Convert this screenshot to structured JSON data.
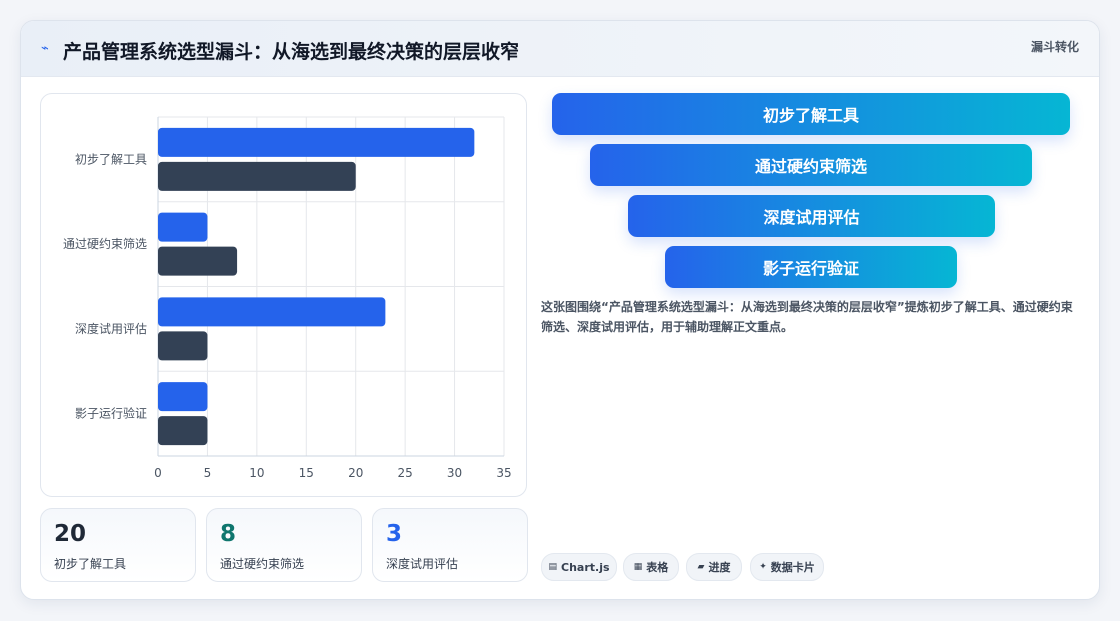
{
  "header": {
    "title": "产品管理系统选型漏斗：从海选到最终决策的层层收窄",
    "tag": "漏斗转化"
  },
  "chart_data": {
    "type": "bar",
    "orientation": "horizontal",
    "categories": [
      "初步了解工具",
      "通过硬约束筛选",
      "深度试用评估",
      "影子运行验证"
    ],
    "series": [
      {
        "values": [
          32,
          5,
          23,
          5
        ],
        "color": "#2563eb"
      },
      {
        "values": [
          20,
          8,
          5,
          5
        ],
        "color": "#334155"
      }
    ],
    "xlim": [
      0,
      35
    ],
    "xticks": [
      0,
      5,
      10,
      15,
      20,
      25,
      30,
      35
    ],
    "grid": true
  },
  "funnel": {
    "stages": [
      "初步了解工具",
      "通过硬约束筛选",
      "深度试用评估",
      "影子运行验证"
    ]
  },
  "description": "这张图围绕“产品管理系统选型漏斗：从海选到最终决策的层层收窄”提炼初步了解工具、通过硬约束筛选、深度试用评估，用于辅助理解正文重点。",
  "stats": [
    {
      "value": "20",
      "label": "初步了解工具",
      "color": "#1f2937"
    },
    {
      "value": "8",
      "label": "通过硬约束筛选",
      "color": "#0f766e"
    },
    {
      "value": "3",
      "label": "深度试用评估",
      "color": "#2563eb"
    }
  ],
  "tags": [
    {
      "icon": "▤",
      "label": "Chart.js"
    },
    {
      "icon": "▦",
      "label": "表格"
    },
    {
      "icon": "▰",
      "label": "进度"
    },
    {
      "icon": "✦",
      "label": "数据卡片"
    }
  ]
}
